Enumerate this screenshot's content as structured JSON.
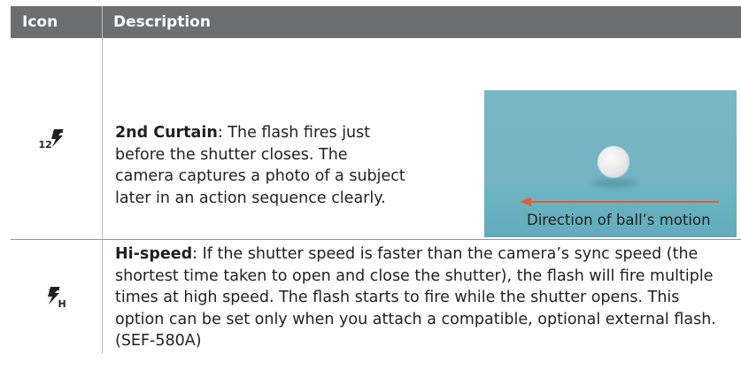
{
  "header": {
    "icon_label": "Icon",
    "description_label": "Description"
  },
  "rows": [
    {
      "icon": "second-curtain-flash-icon",
      "icon_text": "12",
      "term": "2nd Curtain",
      "text": ": The flash fires just before the shutter closes. The camera captures a photo of a subject later in an action sequence clearly.",
      "image": {
        "caption": "Direction of ball’s motion",
        "arrow_color": "#f05a28"
      }
    },
    {
      "icon": "hi-speed-flash-icon",
      "icon_text": "H",
      "term": "Hi-speed",
      "text": ": If the shutter speed is faster than the camera’s sync speed (the shortest time taken to open and close the shutter), the flash will fire multiple times at high speed. The flash starts to fire while the shutter opens. This option can be set only when you attach a compatible, optional external flash. (SEF-580A)"
    }
  ],
  "colors": {
    "header_bg": "#6d6e70",
    "header_text": "#ffffff",
    "body_text": "#231f20",
    "divider": "#bcbec0"
  }
}
